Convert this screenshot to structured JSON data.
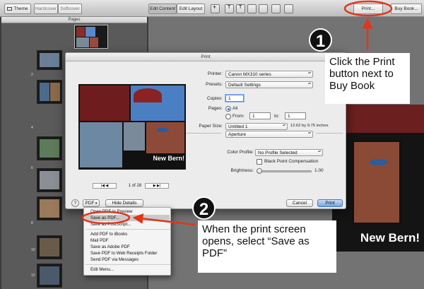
{
  "toolbar": {
    "theme_label": "Theme",
    "hardcover_label": "Hardcover",
    "softcover_label": "Softcover",
    "edit_content_label": "Edit Content",
    "edit_layout_label": "Edit Layout",
    "print_label": "Print...",
    "buy_book_label": "Buy Book..."
  },
  "sidebar": {
    "header": "Pages",
    "page_numbers": [
      "2",
      "4",
      "6",
      "8",
      "10",
      "12"
    ]
  },
  "dialog": {
    "title": "Print",
    "printer_label": "Printer:",
    "printer_value": "Canon MX310 series",
    "presets_label": "Presets:",
    "presets_value": "Default Settings",
    "copies_label": "Copies:",
    "copies_value": "1",
    "pages_label": "Pages:",
    "all_label": "All",
    "from_label": "From:",
    "from_value": "1",
    "to_label": "to:",
    "to_value": "1",
    "paper_size_label": "Paper Size:",
    "paper_size_value": "Untitled 1",
    "paper_dimensions": "12.62 by 9.75 inches",
    "app_section_value": "Aperture",
    "color_profile_label": "Color Profile:",
    "color_profile_value": "No Profile Selected",
    "black_point_label": "Black Point Compensation",
    "brightness_label": "Brightness:",
    "brightness_value": "1.00",
    "brightness_level": 0,
    "page_indicator": "1 of 28",
    "preview_caption": "New Bern!",
    "help_label": "?",
    "pdf_label": "PDF",
    "hide_details_label": "Hide Details",
    "cancel_label": "Cancel",
    "print_label": "Print"
  },
  "pdf_menu": {
    "items": [
      "Open PDF in Preview",
      "Save as PDF...",
      "Save as PostScript...",
      "Add PDF to iBooks",
      "Mail PDF",
      "Save as Adobe PDF",
      "Save PDF to Web Receipts Folder",
      "Send PDF via Messages",
      "Edit Menu..."
    ],
    "selected_index": 1
  },
  "canvas": {
    "spread_caption": "New Bern!"
  },
  "callouts": {
    "step1_number": "1",
    "step1_text": "Click the Print button next to Buy Book",
    "step2_number": "2",
    "step2_text": "When the print screen opens, select “Save as PDF”"
  },
  "colors": {
    "annotation": "#e0361b",
    "menu_highlight": "#c9c9c9",
    "default_button": "#74a3e3"
  }
}
